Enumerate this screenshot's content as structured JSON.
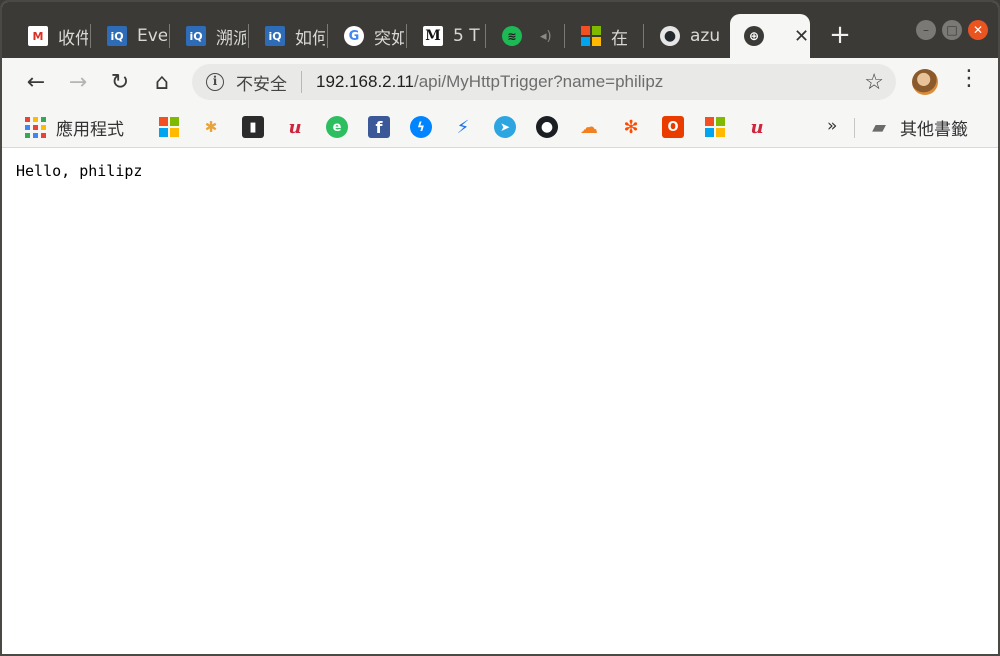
{
  "tabs": [
    {
      "title": "收件",
      "icon": "gmail-icon",
      "color": "#d93025",
      "glyph": "M"
    },
    {
      "title": "Eve",
      "icon": "infoq-icon",
      "color": "#2e6cb8",
      "glyph": "iQ"
    },
    {
      "title": "溯派",
      "icon": "infoq-icon",
      "color": "#2e6cb8",
      "glyph": "iQ"
    },
    {
      "title": "如何",
      "icon": "infoq-icon",
      "color": "#2e6cb8",
      "glyph": "iQ"
    },
    {
      "title": "突如",
      "icon": "google-icon",
      "color": "#4285f4",
      "glyph": "G"
    },
    {
      "title": "5 T",
      "icon": "medium-icon",
      "color": "#111111",
      "glyph": "M"
    },
    {
      "title": "",
      "icon": "spotify-icon",
      "color": "#1db954",
      "glyph": "≋"
    },
    {
      "title": "在",
      "icon": "microsoft-icon",
      "color": "#00a4ef",
      "glyph": ""
    },
    {
      "title": "azu",
      "icon": "github-icon",
      "color": "#24292e",
      "glyph": "●"
    }
  ],
  "active_tab": {
    "title": "",
    "close_glyph": "✕"
  },
  "new_tab_glyph": "+",
  "window_buttons": {
    "minimize": "–",
    "maximize": "□",
    "close": "✕"
  },
  "toolbar": {
    "back": "←",
    "forward": "→",
    "reload": "↻",
    "home": "⌂",
    "star": "☆",
    "menu": "⋮"
  },
  "address": {
    "info_glyph": "i",
    "security_label": "不安全",
    "host": "192.168.2.11",
    "path": "/api/MyHttpTrigger?name=philipz"
  },
  "bookmarks": {
    "apps_label": "應用程式",
    "overflow": "»",
    "other_label": "其他書籤"
  },
  "page": {
    "body_text": "Hello, philipz"
  }
}
